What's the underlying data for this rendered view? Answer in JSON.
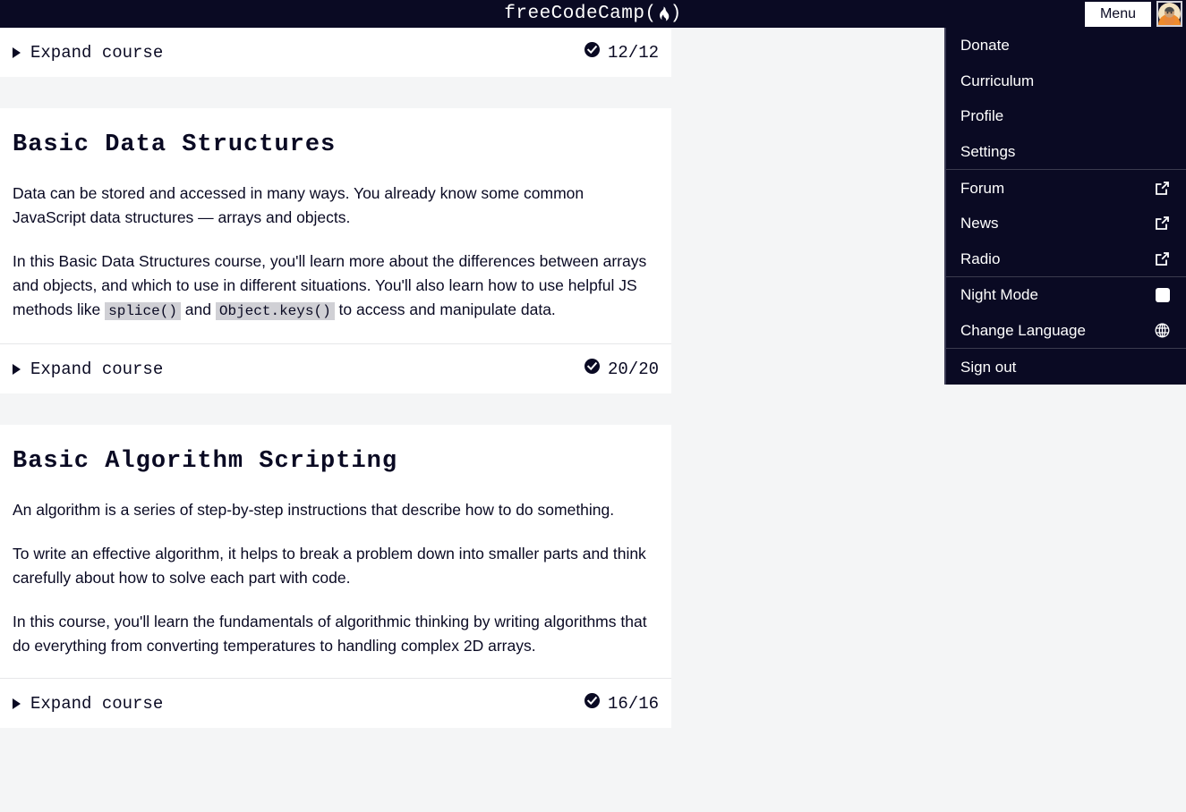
{
  "header": {
    "logo_text": "freeCodeCamp",
    "logo_open_paren": "(",
    "logo_close_paren": ")",
    "logo_icon": "flame-icon",
    "menu_button_label": "Menu",
    "avatar_icon": "user-avatar",
    "background_color": "#0a0a23"
  },
  "nav_menu": {
    "groups": [
      {
        "items": [
          {
            "label": "Donate",
            "icon": ""
          },
          {
            "label": "Curriculum",
            "icon": ""
          },
          {
            "label": "Profile",
            "icon": ""
          },
          {
            "label": "Settings",
            "icon": ""
          }
        ]
      },
      {
        "items": [
          {
            "label": "Forum",
            "icon": "external-link-icon"
          },
          {
            "label": "News",
            "icon": "external-link-icon"
          },
          {
            "label": "Radio",
            "icon": "external-link-icon"
          }
        ]
      },
      {
        "items": [
          {
            "label": "Night Mode",
            "icon": "toggle-off-icon"
          },
          {
            "label": "Change Language",
            "icon": "globe-icon"
          }
        ]
      },
      {
        "items": [
          {
            "label": "Sign out",
            "icon": ""
          }
        ]
      }
    ]
  },
  "main": {
    "top_expand_row": {
      "expand_label": "Expand course",
      "progress_text": "12/12",
      "progress_icon": "check-circle-icon"
    },
    "courses": [
      {
        "title": "Basic Data Structures",
        "paragraphs": [
          {
            "parts": [
              {
                "type": "text",
                "value": "Data can be stored and accessed in many ways. You already know some common JavaScript data structures — arrays and objects."
              }
            ]
          },
          {
            "parts": [
              {
                "type": "text",
                "value": "In this Basic Data Structures course, you'll learn more about the differences between arrays and objects, and which to use in different situations. You'll also learn how to use helpful JS methods like "
              },
              {
                "type": "code",
                "value": "splice()"
              },
              {
                "type": "text",
                "value": " and "
              },
              {
                "type": "code",
                "value": "Object.keys()"
              },
              {
                "type": "text",
                "value": " to access and manipulate data."
              }
            ]
          }
        ],
        "expand_label": "Expand course",
        "progress_text": "20/20",
        "progress_icon": "check-circle-icon"
      },
      {
        "title": "Basic Algorithm Scripting",
        "paragraphs": [
          {
            "parts": [
              {
                "type": "text",
                "value": "An algorithm is a series of step-by-step instructions that describe how to do something."
              }
            ]
          },
          {
            "parts": [
              {
                "type": "text",
                "value": "To write an effective algorithm, it helps to break a problem down into smaller parts and think carefully about how to solve each part with code."
              }
            ]
          },
          {
            "parts": [
              {
                "type": "text",
                "value": "In this course, you'll learn the fundamentals of algorithmic thinking by writing algorithms that do everything from converting temperatures to handling complex 2D arrays."
              }
            ]
          }
        ],
        "expand_label": "Expand course",
        "progress_text": "16/16",
        "progress_icon": "check-circle-icon"
      }
    ]
  },
  "colors": {
    "header_bg": "#0a0a23",
    "page_bg": "#f4f5f6",
    "card_bg": "#ffffff",
    "text": "#0a0a23",
    "code_bg": "#d0d0d5"
  }
}
